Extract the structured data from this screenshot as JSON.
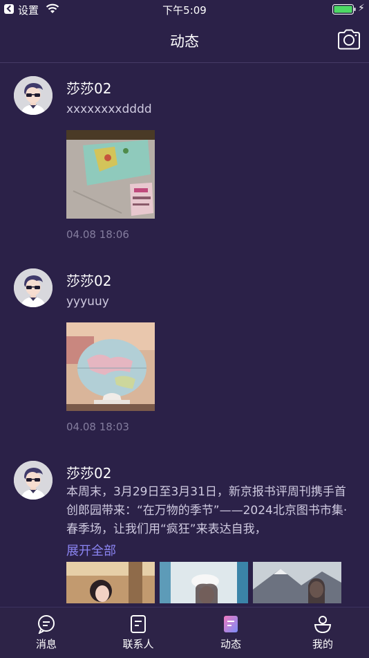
{
  "status_bar": {
    "carrier": "设置",
    "time": "下午5:09"
  },
  "header": {
    "title": "动态"
  },
  "posts": [
    {
      "username": "莎莎02",
      "text": "xxxxxxxxdddd",
      "date": "04.08 18:06"
    },
    {
      "username": "莎莎02",
      "text": "yyyuuy",
      "date": "04.08 18:03"
    },
    {
      "username": "莎莎02",
      "text": "本周末，3月29日至3月31日，新京报书评周刊携手首创郎园带来：“在万物的季节”——2024北京图书市集·春季场，让我们用“疯狂”来表达自我，",
      "expand_label": "展开全部"
    }
  ],
  "tabs": [
    {
      "label": "消息",
      "icon": "message-icon"
    },
    {
      "label": "联系人",
      "icon": "contacts-icon"
    },
    {
      "label": "动态",
      "icon": "moments-icon",
      "active": true
    },
    {
      "label": "我的",
      "icon": "profile-icon"
    }
  ],
  "colors": {
    "background": "#2b2148",
    "accent": "#8b84f2",
    "battery": "#4cd964"
  }
}
